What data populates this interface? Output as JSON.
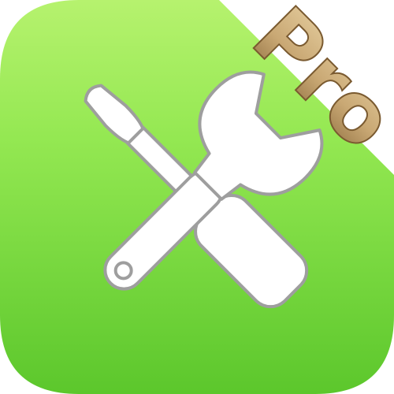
{
  "app_icon": {
    "badge_text": "Pro",
    "tool_icon": "wrench-and-screwdriver-icon",
    "colors": {
      "tile_light": "#B6F26E",
      "tile_mid": "#86E447",
      "tile_dark": "#5CC72C",
      "tool_fill": "#FFFFFF",
      "tool_outline": "#9E9E9E",
      "badge_gold": "#C9A874",
      "badge_gold_dark": "#8E6E3F"
    }
  }
}
